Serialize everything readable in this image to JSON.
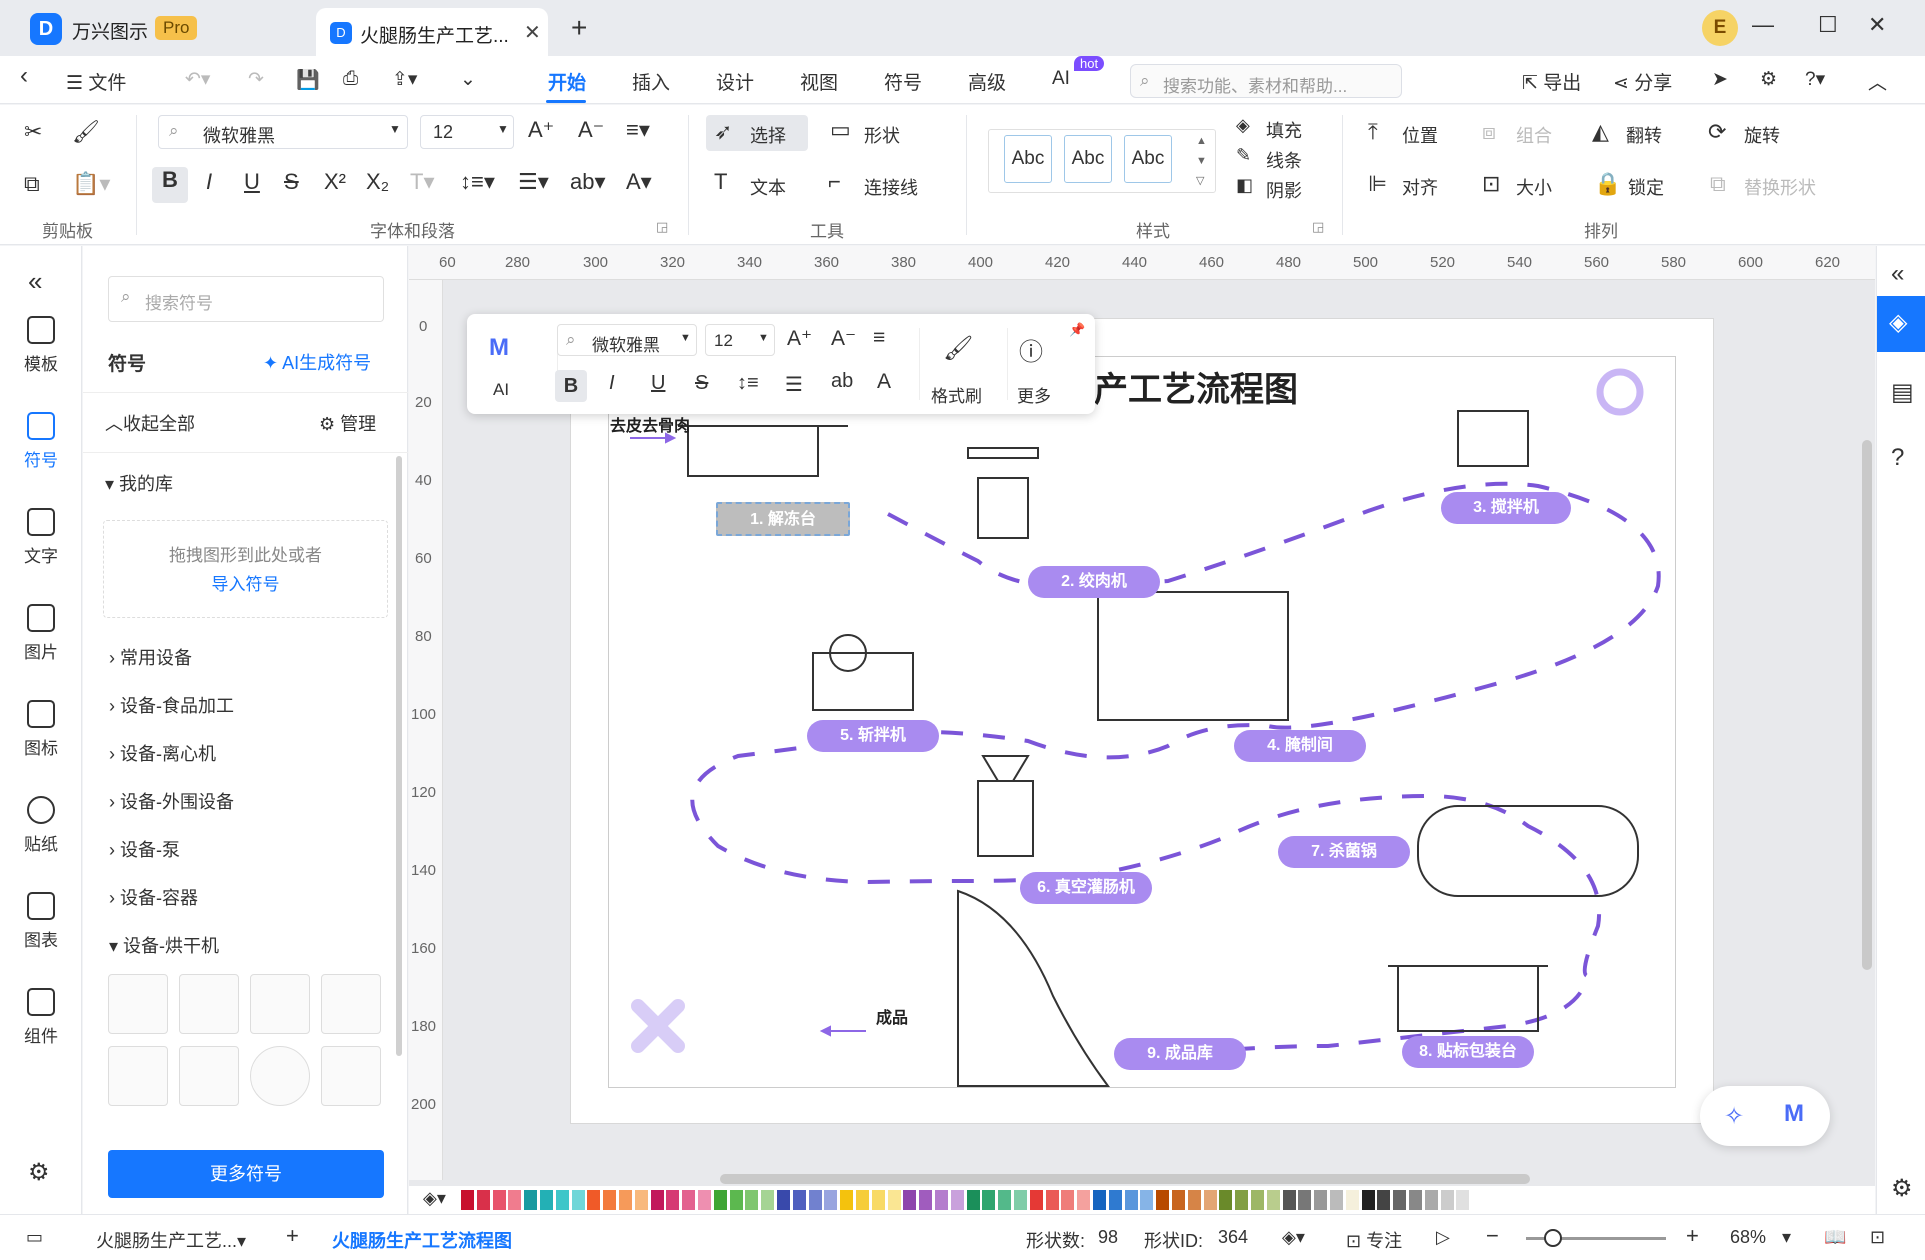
{
  "app": {
    "name": "万兴图示",
    "badge": "Pro",
    "avatar_letter": "E"
  },
  "tabs": [
    {
      "label": "火腿肠生产工艺..."
    }
  ],
  "menu": {
    "back_icon": "back-arrow-icon",
    "file": "文件",
    "items": [
      "开始",
      "插入",
      "设计",
      "视图",
      "符号",
      "高级",
      "AI"
    ],
    "active": "开始",
    "hot": "hot",
    "search_placeholder": "搜索功能、素材和帮助...",
    "export": "导出",
    "share": "分享"
  },
  "ribbon": {
    "font_name": "微软雅黑",
    "font_size": "12",
    "select": "选择",
    "shape": "形状",
    "text": "文本",
    "connector": "连接线",
    "style_samples": [
      "Abc",
      "Abc",
      "Abc"
    ],
    "fill": "填充",
    "line": "线条",
    "shadow": "阴影",
    "position": "位置",
    "group": "组合",
    "flip": "翻转",
    "rotate": "旋转",
    "align": "对齐",
    "size": "大小",
    "lock": "锁定",
    "replace_shape": "替换形状",
    "groups": {
      "clipboard": "剪贴板",
      "font": "字体和段落",
      "tools": "工具",
      "style": "样式",
      "arrange": "排列"
    }
  },
  "leftnav": [
    {
      "label": "模板",
      "icon": "template-icon"
    },
    {
      "label": "符号",
      "icon": "symbol-icon",
      "active": true
    },
    {
      "label": "文字",
      "icon": "text-icon"
    },
    {
      "label": "图片",
      "icon": "image-icon"
    },
    {
      "label": "图标",
      "icon": "icon-library-icon"
    },
    {
      "label": "贴纸",
      "icon": "sticker-icon"
    },
    {
      "label": "图表",
      "icon": "chart-icon"
    },
    {
      "label": "组件",
      "icon": "component-icon"
    }
  ],
  "sympanel": {
    "search_placeholder": "搜索符号",
    "title": "符号",
    "ai_generate": "AI生成符号",
    "collapse_all": "收起全部",
    "manage": "管理",
    "my_lib": "我的库",
    "drop_hint": "拖拽图形到此处或者",
    "import": "导入符号",
    "categories": [
      "常用设备",
      "设备-食品加工",
      "设备-离心机",
      "设备-外围设备",
      "设备-泵",
      "设备-容器",
      "设备-烘干机"
    ],
    "more": "更多符号"
  },
  "ruler": {
    "h": [
      "60",
      "280",
      "300",
      "320",
      "340",
      "360",
      "380",
      "400",
      "420",
      "440",
      "460",
      "480",
      "500",
      "520",
      "540",
      "560",
      "580",
      "600",
      "620"
    ],
    "v": [
      "0",
      "20",
      "40",
      "60",
      "80",
      "100",
      "120",
      "140",
      "160",
      "180",
      "200"
    ]
  },
  "diagram": {
    "title": "产工艺流程图",
    "input_label": "去皮去骨肉",
    "output_label": "成品",
    "steps": [
      "1. 解冻台",
      "2. 绞肉机",
      "3. 搅拌机",
      "4. 腌制间",
      "5. 斩拌机",
      "6. 真空灌肠机",
      "7. 杀菌锅",
      "8. 贴标包装台",
      "9. 成品库"
    ],
    "accent": "#a98bf0",
    "dash_color": "#7b55d8"
  },
  "floattb": {
    "ai": "AI",
    "font_name": "微软雅黑",
    "font_size": "12",
    "format_painter": "格式刷",
    "more": "更多"
  },
  "palette": [
    "#c8102e",
    "#d9304a",
    "#e8546c",
    "#f07c8e",
    "#1a9aa0",
    "#23b0b5",
    "#3ec6c9",
    "#6fd6d8",
    "#f05a28",
    "#f37a3c",
    "#f69a5a",
    "#f8b97c",
    "#c2185b",
    "#d63a73",
    "#e3628f",
    "#ee8fb0",
    "#3fa535",
    "#5cb84f",
    "#7fc66f",
    "#a5d494",
    "#3949ab",
    "#4f5fbf",
    "#7181cf",
    "#98a4df",
    "#f4c20d",
    "#f6cd39",
    "#f8da66",
    "#fae693",
    "#8e44ad",
    "#a05cbe",
    "#b47ccd",
    "#c9a1dc",
    "#1b8f5a",
    "#2ea56e",
    "#53b98a",
    "#7fcda8",
    "#e53935",
    "#ea5a57",
    "#ef7d7a",
    "#f4a19e",
    "#1565c0",
    "#2f7ad0",
    "#5a97dc",
    "#86b4e7",
    "#b84a00",
    "#c8651f",
    "#d68447",
    "#e3a574",
    "#6a8a2a",
    "#829f44",
    "#9db766",
    "#b9cd8d",
    "#555555",
    "#777777",
    "#999999",
    "#bbbbbb",
    "#f5f0dc",
    "#222222",
    "#444444",
    "#666666",
    "#888888",
    "#aaaaaa",
    "#cccccc",
    "#e0e0e0"
  ],
  "status": {
    "page_tab": "火腿肠生产工艺...",
    "page_active": "火腿肠生产工艺流程图",
    "shape_count_label": "形状数:",
    "shape_count": "98",
    "shape_id_label": "形状ID:",
    "shape_id": "364",
    "focus": "专注",
    "zoom": "68%"
  }
}
